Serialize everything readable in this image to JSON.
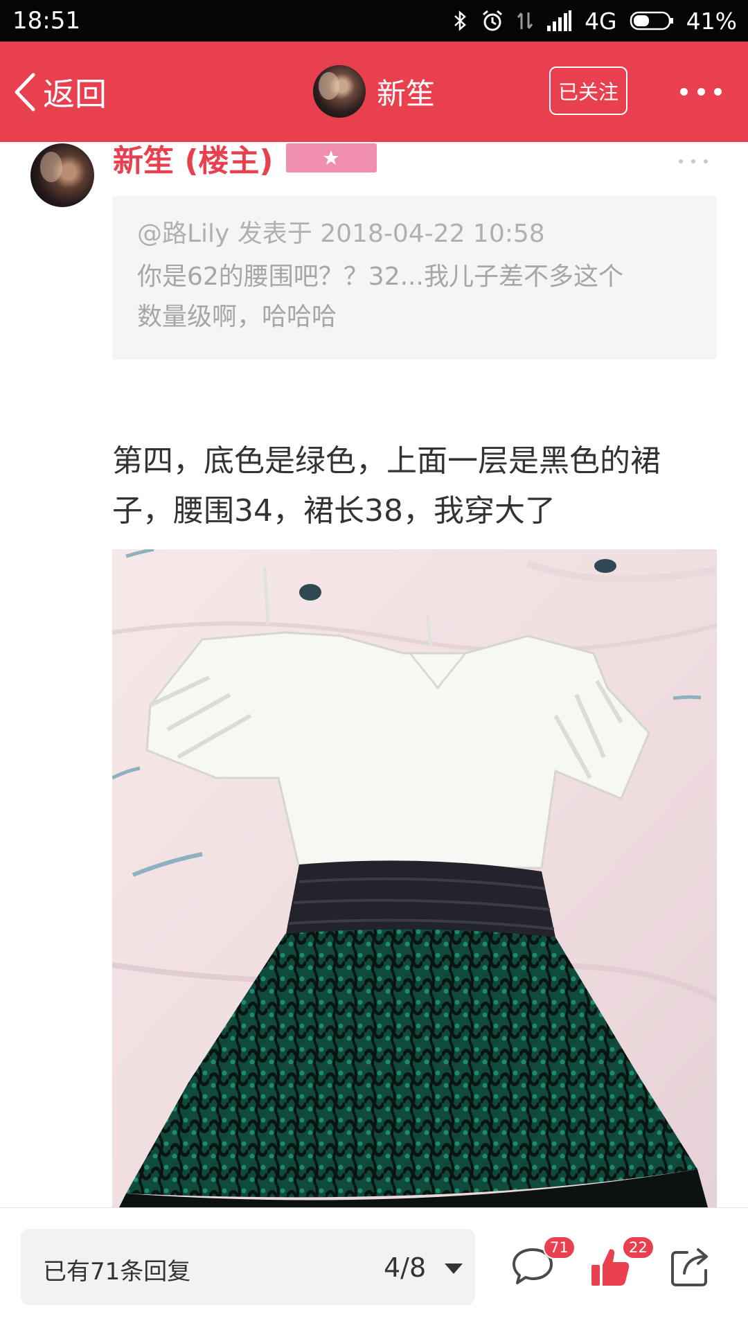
{
  "status_bar": {
    "time": "18:51",
    "network": "4G",
    "battery": "41%",
    "icons": [
      "bluetooth-icon",
      "alarm-icon",
      "data-transfer-icon",
      "signal-icon",
      "battery-icon"
    ]
  },
  "header": {
    "back_label": "返回",
    "title": "新笙",
    "follow_label": "已关注",
    "accent_color": "#e8404f",
    "icons": [
      "chevron-left-icon",
      "more-icon"
    ]
  },
  "post": {
    "author": "新笙 (楼主)",
    "badge_color": "#ef8eb0",
    "quote": {
      "meta": "@路Lily 发表于 2018-04-22 10:58",
      "lines": [
        "你是62的腰围吧？？32...我儿子差不多这个",
        "数量级啊，哈哈哈"
      ]
    },
    "body_lines": [
      "第四，底色是绿色，上面一层是黑色的裙",
      "子，腰围34，裙长38，我穿大了"
    ]
  },
  "bottom_bar": {
    "reply_count": "已有71条回复",
    "page_indicator": "4/8",
    "comment_badge": "71",
    "like_badge": "22",
    "icons": [
      "comment-icon",
      "thumbs-up-icon",
      "share-icon"
    ]
  }
}
